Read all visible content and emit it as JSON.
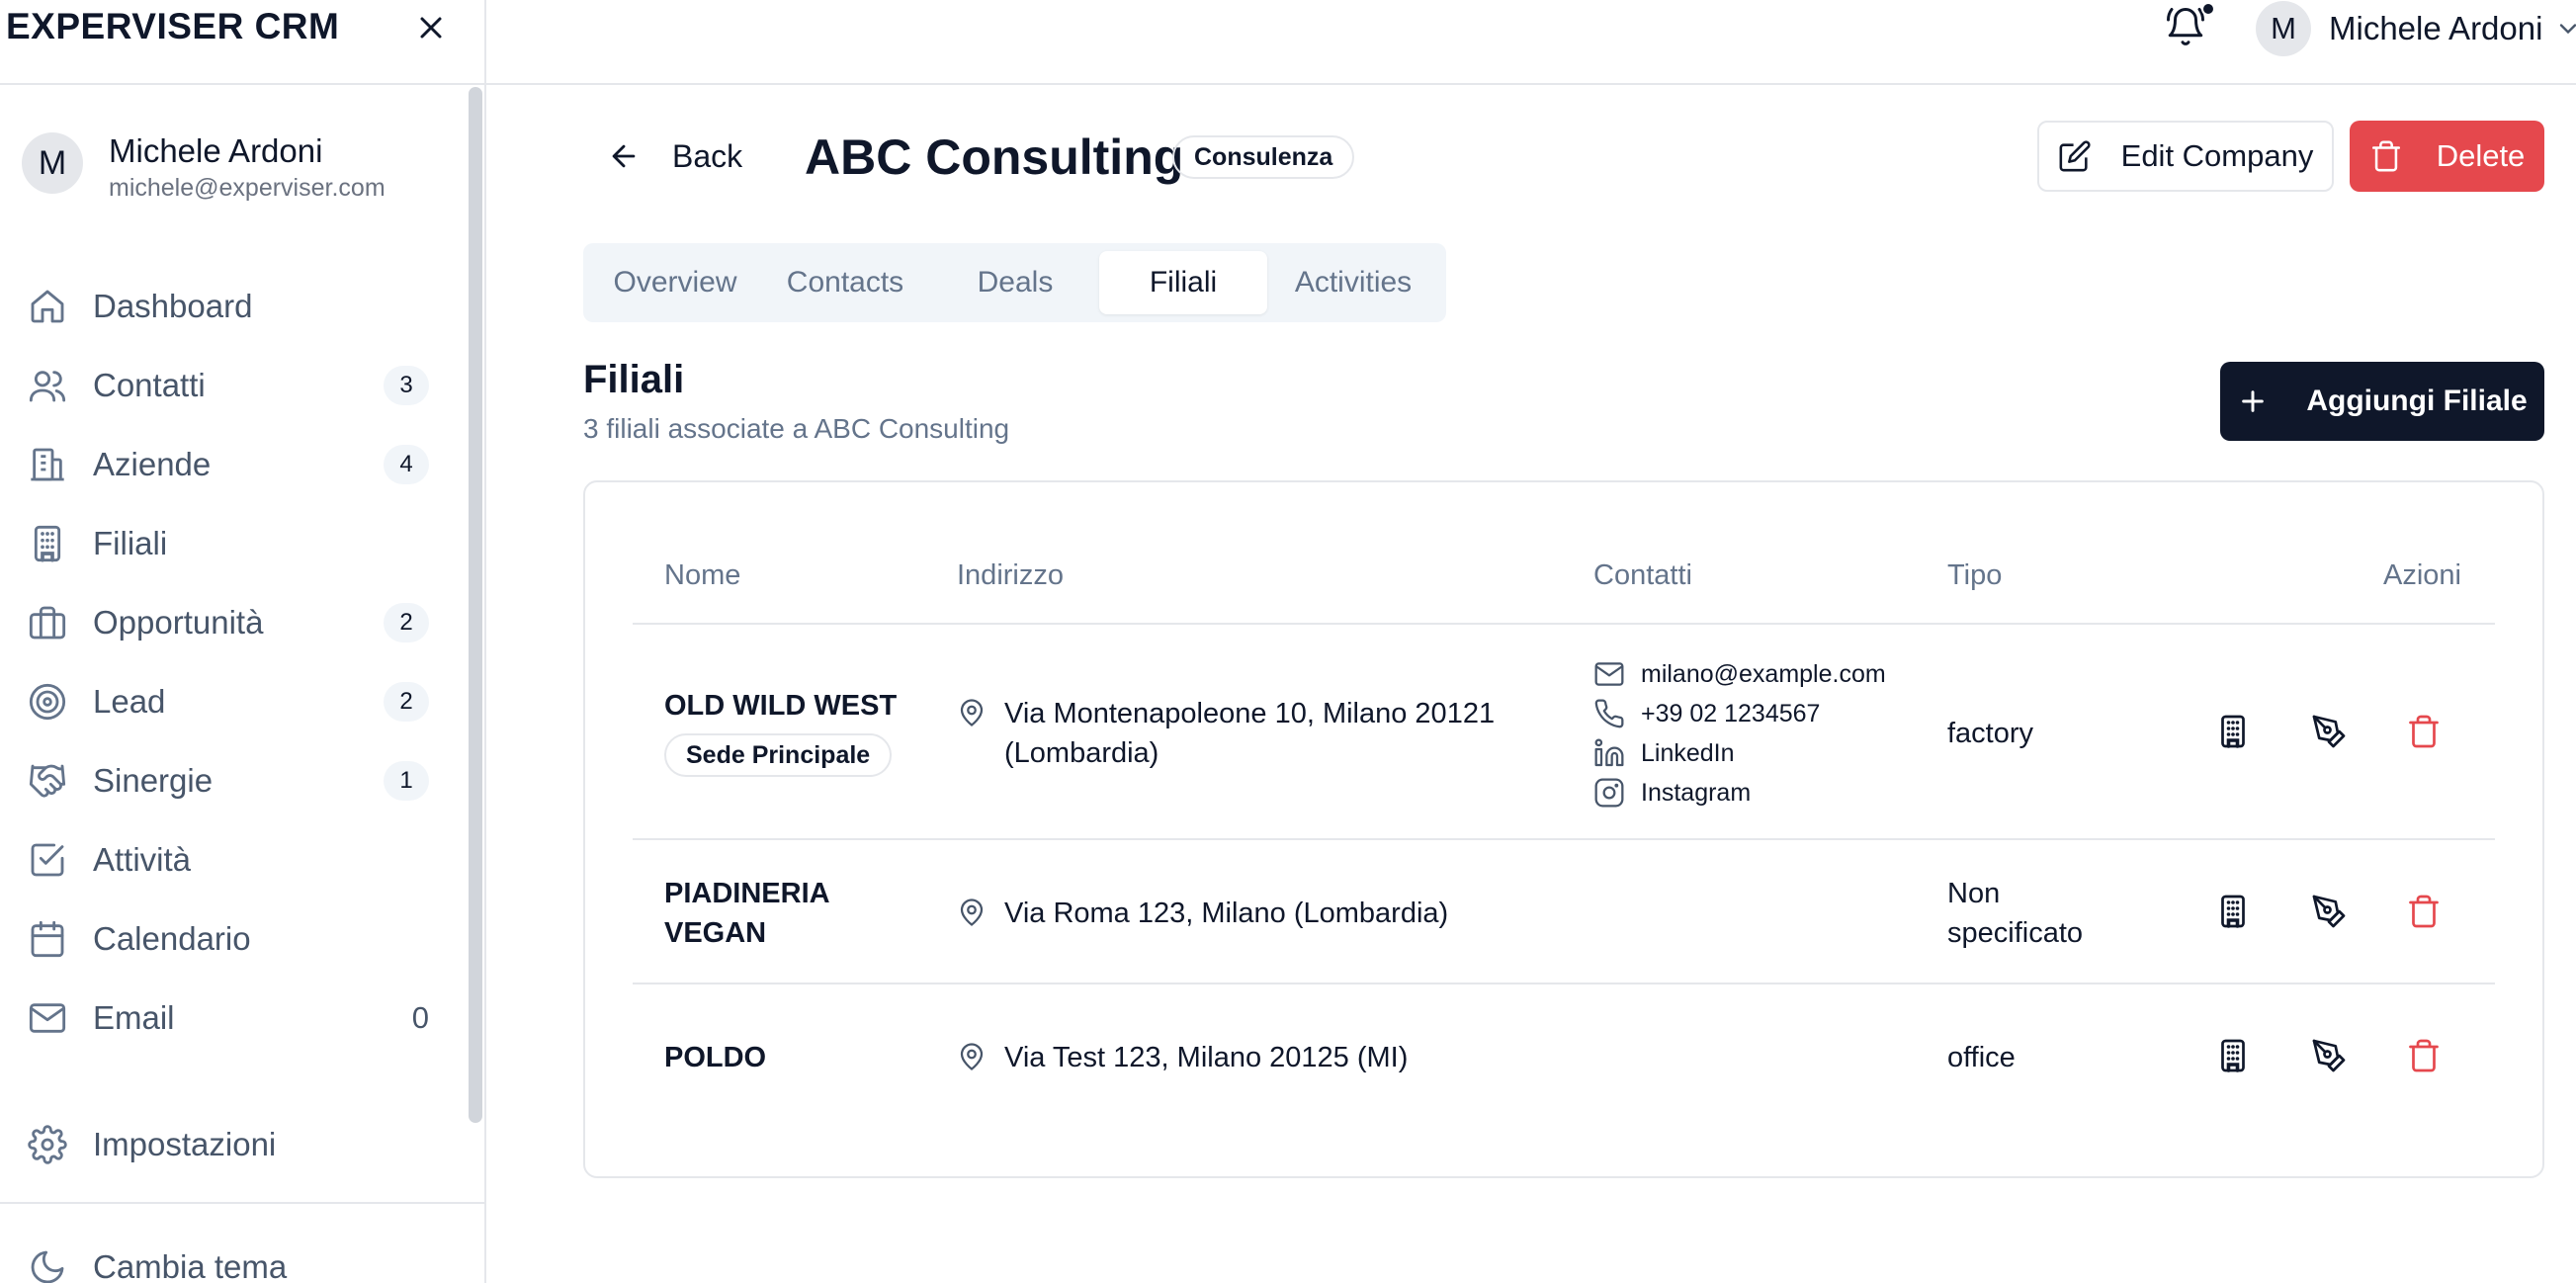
{
  "sidebar": {
    "brand": "EXPERVISER CRM",
    "user": {
      "initial": "M",
      "name": "Michele Ardoni",
      "email": "michele@experviser.com"
    },
    "items": [
      {
        "label": "Dashboard",
        "icon": "home-icon"
      },
      {
        "label": "Contatti",
        "icon": "users-icon",
        "badge": "3"
      },
      {
        "label": "Aziende",
        "icon": "buildings-icon",
        "badge": "4"
      },
      {
        "label": "Filiali",
        "icon": "building-icon"
      },
      {
        "label": "Opportunità",
        "icon": "briefcase-icon",
        "badge": "2"
      },
      {
        "label": "Lead",
        "icon": "target-icon",
        "badge": "2"
      },
      {
        "label": "Sinergie",
        "icon": "handshake-icon",
        "badge": "1"
      },
      {
        "label": "Attività",
        "icon": "checkbox-icon"
      },
      {
        "label": "Calendario",
        "icon": "calendar-icon"
      },
      {
        "label": "Email",
        "icon": "mail-icon",
        "count": "0"
      }
    ],
    "settings_label": "Impostazioni",
    "theme_label": "Cambia tema"
  },
  "topbar": {
    "user_initial": "M",
    "user_name": "Michele Ardoni"
  },
  "header": {
    "back_label": "Back",
    "company_name": "ABC Consulting",
    "category": "Consulenza",
    "edit_label": "Edit Company",
    "delete_label": "Delete"
  },
  "tabs": [
    {
      "label": "Overview",
      "active": false
    },
    {
      "label": "Contacts",
      "active": false
    },
    {
      "label": "Deals",
      "active": false
    },
    {
      "label": "Filiali",
      "active": true
    },
    {
      "label": "Activities",
      "active": false
    }
  ],
  "section": {
    "title": "Filiali",
    "subtitle": "3 filiali associate a ABC Consulting",
    "add_label": "Aggiungi Filiale"
  },
  "table": {
    "headers": {
      "name": "Nome",
      "address": "Indirizzo",
      "contacts": "Contatti",
      "type": "Tipo",
      "actions": "Azioni"
    },
    "rows": [
      {
        "name": "OLD WILD WEST",
        "badge": "Sede Principale",
        "address_line1": "Via Montenapoleone 10, Milano 20121",
        "address_line2": "(Lombardia)",
        "email": "milano@example.com",
        "phone": "+39 02 1234567",
        "linkedin": "LinkedIn",
        "instagram": "Instagram",
        "type": "factory"
      },
      {
        "name_line1": "PIADINERIA",
        "name_line2": "VEGAN",
        "address": "Via Roma 123, Milano (Lombardia)",
        "type_line1": "Non",
        "type_line2": "specificato"
      },
      {
        "name": "POLDO",
        "address": "Via Test 123, Milano 20125 (MI)",
        "type": "office"
      }
    ]
  },
  "colors": {
    "primary": "#0f172a",
    "danger": "#e5484d",
    "muted": "#64748b",
    "border": "#e5e7eb"
  }
}
